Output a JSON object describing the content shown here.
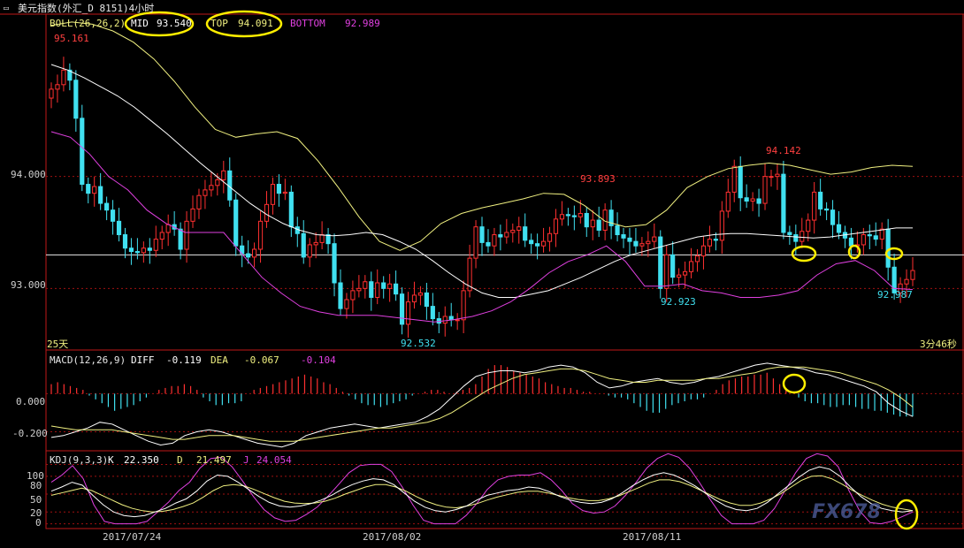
{
  "window": {
    "title": "美元指数(外汇_D 8151)4小时",
    "title_icon": "window-control-icon"
  },
  "colors": {
    "up": "#ff3030",
    "down": "#40e0f0",
    "mid": "#ffffff",
    "top": "#f0f080",
    "bottom": "#e040e0",
    "grid": "#a01010",
    "axis": "#c01818",
    "text_red": "#ff4040",
    "text_cyan": "#40e0f0",
    "highlight": "#ffee00",
    "watermark": "#5060a0"
  },
  "main_panel": {
    "indicator_label": "BOLL(26,26,2)",
    "mid_label": "MID",
    "mid_value": "93.540",
    "top_label": "TOP",
    "top_value": "94.091",
    "bottom_label": "BOTTOM",
    "bottom_value": "92.989",
    "y_ticks": [
      "94.000",
      "93.000"
    ],
    "period_label": "25天",
    "timer_label": "3分46秒",
    "annotations": [
      "95.161",
      "92.532",
      "93.893",
      "92.923",
      "94.142",
      "92.987"
    ]
  },
  "macd_panel": {
    "label": "MACD(12,26,9)",
    "diff_label": "DIFF",
    "diff_value": "-0.119",
    "dea_label": "DEA",
    "dea_value": "-0.067",
    "macd_value": "-0.104",
    "y_ticks": [
      "0.000",
      "-0.200"
    ]
  },
  "kdj_panel": {
    "label": "KDJ(9,3,3)",
    "k_label": "K",
    "k_value": "22.350",
    "d_label": "D",
    "d_value": "21.497",
    "j_label": "J",
    "j_value": "24.054",
    "y_ticks": [
      "100",
      "80",
      "50",
      "20",
      "0"
    ]
  },
  "x_axis": {
    "dates": [
      "2017/07/24",
      "2017/08/02",
      "2017/08/11"
    ]
  },
  "watermark": {
    "text": "FX678"
  },
  "chart_data": {
    "type": "candlestick",
    "main": {
      "y_range": [
        92.45,
        95.45
      ],
      "closes": [
        94.78,
        94.82,
        94.95,
        94.86,
        94.52,
        93.93,
        93.85,
        93.91,
        93.76,
        93.7,
        93.6,
        93.48,
        93.36,
        93.33,
        93.32,
        93.36,
        93.34,
        93.44,
        93.5,
        93.57,
        93.53,
        93.35,
        93.6,
        93.71,
        93.83,
        93.88,
        93.92,
        93.97,
        94.05,
        93.79,
        93.38,
        93.31,
        93.28,
        93.35,
        93.6,
        93.75,
        93.93,
        93.85,
        93.86,
        93.55,
        93.49,
        93.28,
        93.39,
        93.41,
        93.48,
        93.4,
        93.05,
        92.82,
        92.9,
        92.98,
        93.0,
        93.06,
        92.92,
        93.05,
        93.0,
        93.04,
        92.95,
        92.68,
        92.88,
        92.94,
        92.96,
        92.84,
        92.73,
        92.69,
        92.75,
        92.72,
        92.72,
        92.98,
        93.27,
        93.55,
        93.41,
        93.38,
        93.48,
        93.46,
        93.5,
        93.52,
        93.55,
        93.43,
        93.4,
        93.38,
        93.42,
        93.49,
        93.62,
        93.66,
        93.65,
        93.64,
        93.67,
        93.55,
        93.61,
        93.52,
        93.7,
        93.56,
        93.48,
        93.45,
        93.42,
        93.38,
        93.4,
        93.42,
        93.46,
        93.0,
        93.3,
        93.1,
        93.12,
        93.15,
        93.24,
        93.29,
        93.38,
        93.44,
        93.43,
        93.69,
        93.86,
        94.09,
        93.81,
        93.78,
        93.8,
        93.76,
        94.0,
        94.0,
        94.02,
        93.5,
        93.48,
        93.42,
        93.51,
        93.61,
        93.86,
        93.71,
        93.7,
        93.57,
        93.5,
        93.45,
        93.38,
        93.39,
        93.48,
        93.47,
        93.44,
        93.53,
        93.19,
        92.96,
        93.04,
        93.08,
        93.16
      ],
      "opens": [
        94.7,
        94.78,
        94.82,
        94.95,
        94.86,
        94.52,
        93.93,
        93.85,
        93.91,
        93.76,
        93.7,
        93.6,
        93.48,
        93.36,
        93.33,
        93.32,
        93.36,
        93.34,
        93.44,
        93.5,
        93.57,
        93.53,
        93.35,
        93.6,
        93.71,
        93.83,
        93.88,
        93.92,
        93.97,
        94.05,
        93.79,
        93.38,
        93.31,
        93.28,
        93.35,
        93.6,
        93.75,
        93.93,
        93.85,
        93.86,
        93.55,
        93.49,
        93.28,
        93.39,
        93.41,
        93.48,
        93.4,
        93.05,
        92.82,
        92.9,
        92.98,
        93.0,
        93.06,
        92.92,
        93.05,
        93.0,
        93.04,
        92.95,
        92.68,
        92.88,
        92.94,
        92.96,
        92.84,
        92.73,
        92.69,
        92.75,
        92.72,
        92.72,
        92.98,
        93.27,
        93.55,
        93.41,
        93.38,
        93.48,
        93.46,
        93.5,
        93.52,
        93.55,
        93.43,
        93.4,
        93.38,
        93.42,
        93.49,
        93.62,
        93.66,
        93.65,
        93.64,
        93.67,
        93.55,
        93.61,
        93.52,
        93.7,
        93.56,
        93.48,
        93.45,
        93.42,
        93.38,
        93.4,
        93.42,
        93.46,
        93.0,
        93.3,
        93.1,
        93.12,
        93.15,
        93.24,
        93.29,
        93.38,
        93.44,
        93.43,
        93.69,
        93.86,
        94.09,
        93.81,
        93.78,
        93.8,
        93.76,
        94.0,
        94.0,
        94.02,
        93.5,
        93.48,
        93.42,
        93.51,
        93.61,
        93.86,
        93.71,
        93.7,
        93.57,
        93.5,
        93.45,
        93.38,
        93.39,
        93.48,
        93.47,
        93.44,
        93.53,
        93.19,
        92.96,
        93.04,
        93.08
      ],
      "mid_line": [
        95.0,
        94.95,
        94.88,
        94.8,
        94.72,
        94.62,
        94.5,
        94.38,
        94.25,
        94.12,
        94.0,
        93.88,
        93.76,
        93.66,
        93.58,
        93.52,
        93.48,
        93.47,
        93.48,
        93.5,
        93.48,
        93.42,
        93.35,
        93.25,
        93.14,
        93.04,
        92.96,
        92.92,
        92.92,
        92.95,
        92.98,
        93.04,
        93.1,
        93.17,
        93.24,
        93.3,
        93.34,
        93.38,
        93.42,
        93.46,
        93.48,
        93.49,
        93.49,
        93.48,
        93.47,
        93.46,
        93.45,
        93.46,
        93.48,
        93.5,
        93.52,
        93.54,
        93.54
      ],
      "top_line": [
        95.35,
        95.38,
        95.36,
        95.3,
        95.2,
        95.05,
        94.85,
        94.62,
        94.42,
        94.35,
        94.38,
        94.4,
        94.34,
        94.14,
        93.9,
        93.64,
        93.42,
        93.34,
        93.42,
        93.58,
        93.67,
        93.72,
        93.76,
        93.8,
        93.85,
        93.84,
        93.74,
        93.6,
        93.55,
        93.57,
        93.7,
        93.9,
        94.0,
        94.07,
        94.1,
        94.12,
        94.1,
        94.06,
        94.02,
        94.04,
        94.08,
        94.1,
        94.09
      ],
      "bottom_line": [
        94.4,
        94.35,
        94.2,
        94.0,
        93.88,
        93.7,
        93.58,
        93.5,
        93.5,
        93.5,
        93.3,
        93.1,
        92.96,
        92.84,
        92.79,
        92.76,
        92.76,
        92.76,
        92.74,
        92.72,
        92.7,
        92.72,
        92.75,
        92.8,
        92.88,
        93.0,
        93.14,
        93.24,
        93.3,
        93.38,
        93.24,
        93.02,
        93.02,
        93.04,
        92.98,
        92.96,
        92.92,
        92.92,
        92.94,
        92.98,
        93.12,
        93.22,
        93.25,
        93.16,
        93.0,
        92.99
      ],
      "current_price_line": 93.3
    },
    "macd": {
      "y_range": [
        -0.3,
        0.22
      ],
      "hist": [
        0.05,
        0.06,
        0.05,
        0.04,
        0.03,
        0.02,
        -0.01,
        -0.03,
        -0.05,
        -0.07,
        -0.09,
        -0.08,
        -0.07,
        -0.06,
        -0.04,
        -0.02,
        0.0,
        0.02,
        0.03,
        0.04,
        0.04,
        0.05,
        0.04,
        0.02,
        -0.02,
        -0.04,
        -0.06,
        -0.06,
        -0.05,
        -0.05,
        -0.04,
        0.0,
        0.02,
        0.03,
        0.04,
        0.05,
        0.06,
        0.07,
        0.08,
        0.09,
        0.1,
        0.09,
        0.08,
        0.06,
        0.05,
        0.03,
        0.01,
        -0.01,
        -0.03,
        -0.05,
        -0.06,
        -0.06,
        -0.07,
        -0.06,
        -0.05,
        -0.04,
        -0.03,
        -0.01,
        0.0,
        0.01,
        0.02,
        0.02,
        0.01,
        0.0,
        0.01,
        0.02,
        0.03,
        0.05,
        0.09,
        0.13,
        0.15,
        0.15,
        0.14,
        0.12,
        0.11,
        0.1,
        0.09,
        0.08,
        0.06,
        0.05,
        0.04,
        0.03,
        0.03,
        0.02,
        0.01,
        0.01,
        0.0,
        0.0,
        -0.01,
        -0.02,
        -0.02,
        -0.03,
        -0.05,
        -0.07,
        -0.09,
        -0.1,
        -0.1,
        -0.08,
        -0.06,
        -0.05,
        -0.04,
        -0.03,
        -0.03,
        -0.02,
        0.0,
        0.02,
        0.05,
        0.07,
        0.08,
        0.09,
        0.09,
        0.1,
        0.1,
        0.11,
        0.08,
        0.05,
        0.03,
        0.0,
        -0.02,
        -0.04,
        -0.05,
        -0.05,
        -0.06,
        -0.07,
        -0.07,
        -0.06,
        -0.06,
        -0.07,
        -0.08,
        -0.08,
        -0.09,
        -0.09,
        -0.1,
        -0.11,
        -0.12,
        -0.12,
        -0.12
      ],
      "diff": [
        -0.23,
        -0.22,
        -0.2,
        -0.18,
        -0.15,
        -0.16,
        -0.19,
        -0.22,
        -0.25,
        -0.27,
        -0.26,
        -0.22,
        -0.2,
        -0.19,
        -0.2,
        -0.22,
        -0.24,
        -0.26,
        -0.27,
        -0.28,
        -0.26,
        -0.22,
        -0.2,
        -0.18,
        -0.17,
        -0.16,
        -0.17,
        -0.18,
        -0.17,
        -0.16,
        -0.15,
        -0.12,
        -0.08,
        -0.02,
        0.04,
        0.09,
        0.11,
        0.12,
        0.12,
        0.11,
        0.12,
        0.14,
        0.15,
        0.14,
        0.11,
        0.06,
        0.03,
        0.04,
        0.06,
        0.07,
        0.08,
        0.06,
        0.05,
        0.06,
        0.08,
        0.09,
        0.11,
        0.13,
        0.15,
        0.16,
        0.15,
        0.14,
        0.13,
        0.11,
        0.1,
        0.08,
        0.06,
        0.04,
        0.01,
        -0.05,
        -0.09,
        -0.12
      ],
      "dea": [
        -0.17,
        -0.18,
        -0.19,
        -0.19,
        -0.19,
        -0.19,
        -0.2,
        -0.21,
        -0.22,
        -0.23,
        -0.24,
        -0.24,
        -0.23,
        -0.22,
        -0.22,
        -0.22,
        -0.23,
        -0.24,
        -0.25,
        -0.25,
        -0.25,
        -0.24,
        -0.23,
        -0.22,
        -0.21,
        -0.2,
        -0.19,
        -0.18,
        -0.18,
        -0.17,
        -0.16,
        -0.15,
        -0.13,
        -0.1,
        -0.06,
        -0.02,
        0.02,
        0.05,
        0.08,
        0.1,
        0.11,
        0.12,
        0.13,
        0.13,
        0.12,
        0.1,
        0.08,
        0.07,
        0.06,
        0.06,
        0.07,
        0.07,
        0.07,
        0.07,
        0.08,
        0.08,
        0.09,
        0.1,
        0.11,
        0.13,
        0.14,
        0.14,
        0.14,
        0.13,
        0.12,
        0.11,
        0.09,
        0.07,
        0.05,
        0.02,
        -0.02,
        -0.07
      ]
    },
    "kdj": {
      "y_range": [
        -8,
        120
      ],
      "k": [
        55,
        62,
        70,
        65,
        48,
        32,
        20,
        14,
        12,
        14,
        20,
        26,
        35,
        42,
        55,
        72,
        82,
        80,
        70,
        58,
        46,
        36,
        30,
        28,
        30,
        34,
        40,
        48,
        58,
        66,
        72,
        76,
        74,
        66,
        52,
        38,
        28,
        22,
        20,
        24,
        30,
        40,
        48,
        52,
        56,
        58,
        62,
        60,
        54,
        46,
        40,
        36,
        34,
        36,
        42,
        52,
        64,
        74,
        82,
        86,
        82,
        74,
        64,
        52,
        40,
        30,
        24,
        22,
        26,
        36,
        50,
        64,
        78,
        90,
        96,
        92,
        80,
        62,
        46,
        34,
        26,
        22,
        20,
        22
      ],
      "d": [
        48,
        52,
        56,
        60,
        56,
        48,
        40,
        32,
        26,
        22,
        20,
        21,
        24,
        29,
        35,
        45,
        56,
        64,
        66,
        64,
        58,
        51,
        44,
        38,
        35,
        34,
        35,
        38,
        43,
        50,
        56,
        62,
        66,
        66,
        62,
        55,
        46,
        38,
        32,
        28,
        27,
        30,
        34,
        40,
        45,
        49,
        53,
        55,
        55,
        52,
        48,
        44,
        41,
        39,
        39,
        42,
        47,
        54,
        61,
        69,
        74,
        74,
        71,
        65,
        57,
        49,
        41,
        35,
        31,
        31,
        35,
        42,
        51,
        62,
        73,
        80,
        81,
        76,
        67,
        57,
        48,
        40,
        33,
        28,
        25,
        22
      ],
      "j": [
        70,
        82,
        98,
        76,
        32,
        4,
        0,
        0,
        0,
        4,
        20,
        36,
        56,
        70,
        94,
        110,
        112,
        96,
        72,
        46,
        24,
        10,
        4,
        6,
        16,
        28,
        46,
        66,
        86,
        98,
        100,
        100,
        88,
        62,
        32,
        6,
        0,
        0,
        0,
        14,
        34,
        58,
        74,
        80,
        82,
        82,
        86,
        74,
        56,
        34,
        22,
        18,
        20,
        30,
        48,
        70,
        94,
        110,
        118,
        112,
        94,
        68,
        40,
        14,
        0,
        0,
        0,
        6,
        26,
        56,
        86,
        110,
        118,
        114,
        96,
        56,
        22,
        2,
        0,
        4,
        12,
        20
      ]
    }
  }
}
